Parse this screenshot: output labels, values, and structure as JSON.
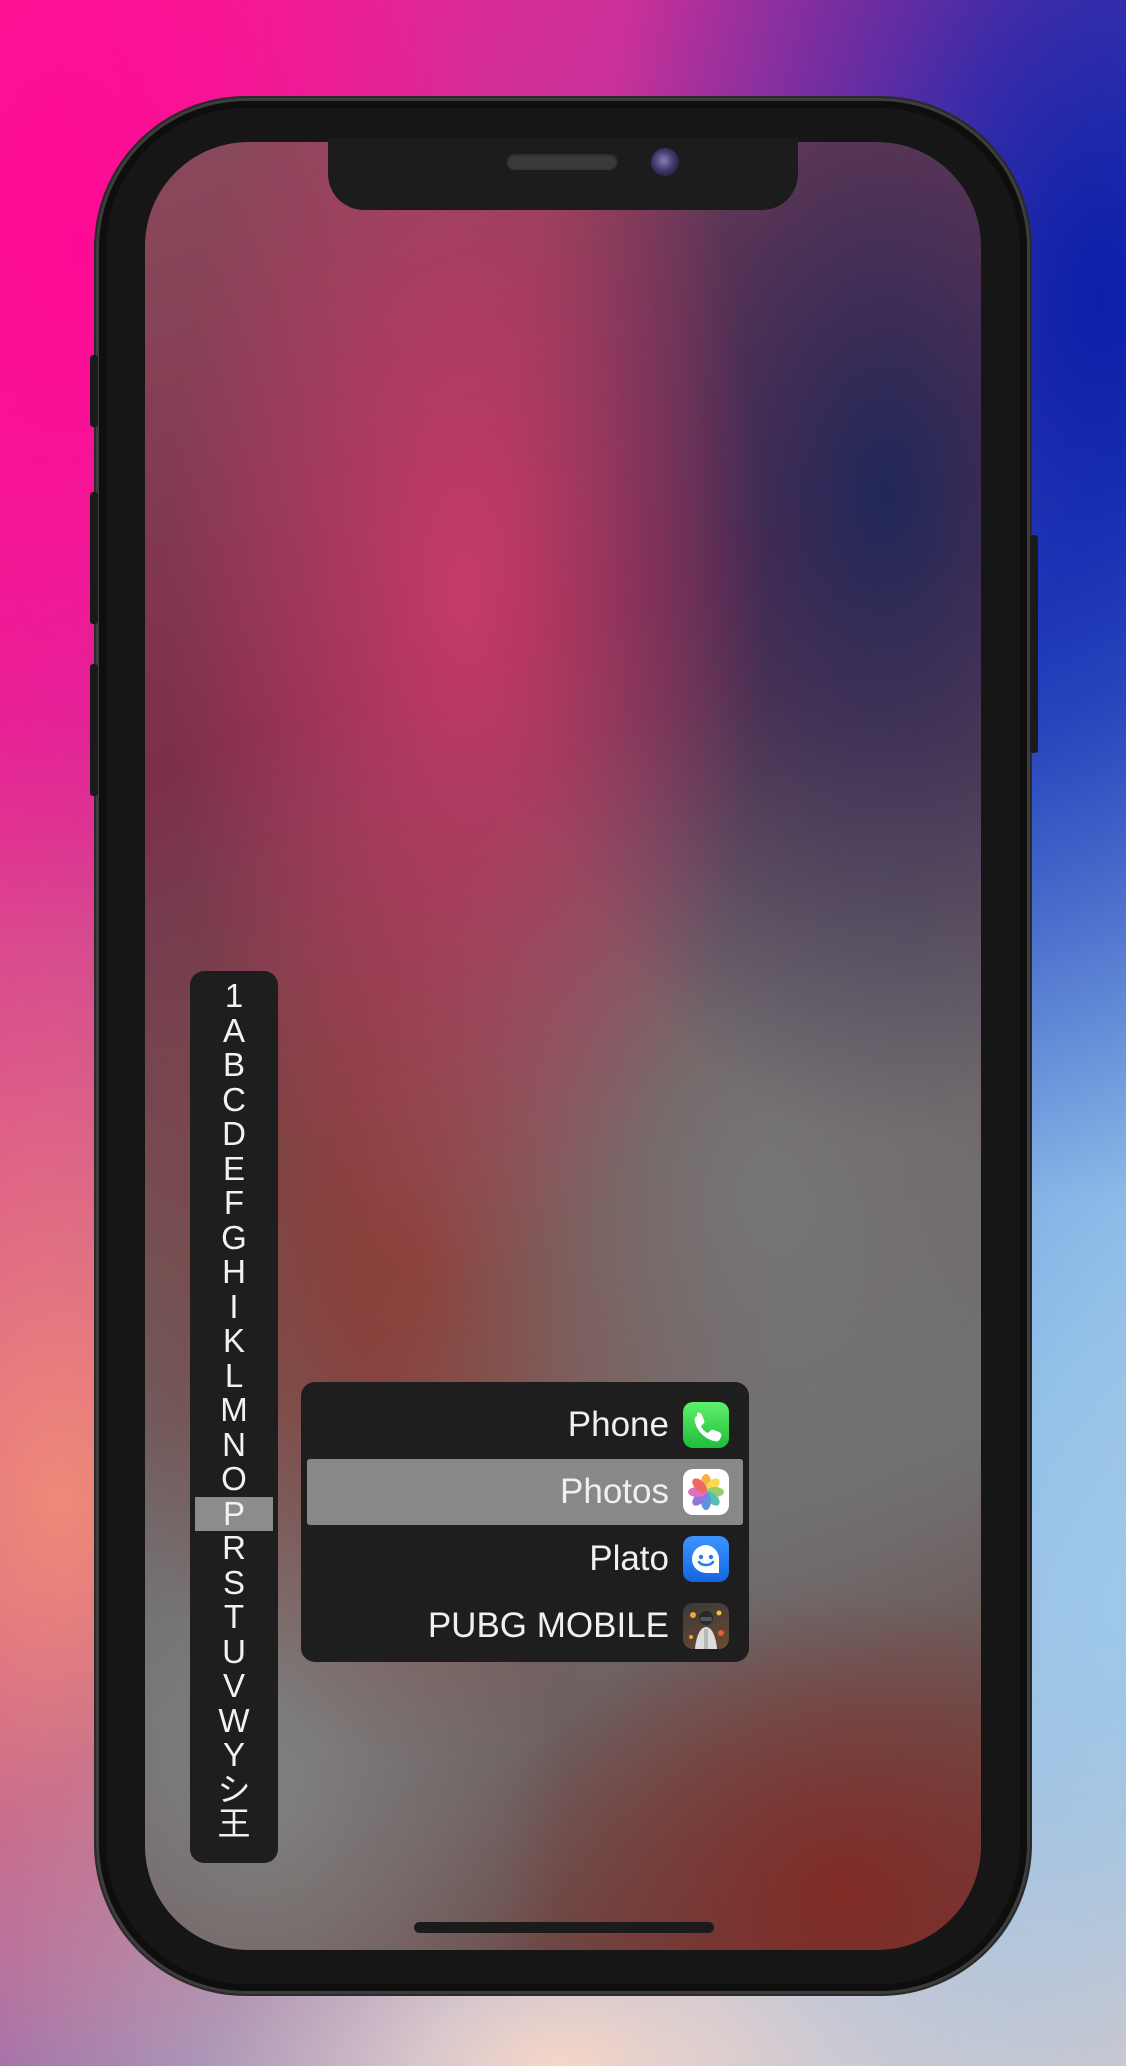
{
  "index_bar": {
    "letters": [
      "1",
      "A",
      "B",
      "C",
      "D",
      "E",
      "F",
      "G",
      "H",
      "I",
      "K",
      "L",
      "M",
      "N",
      "O",
      "P",
      "R",
      "S",
      "T",
      "U",
      "V",
      "W",
      "Y",
      "シ",
      "王"
    ],
    "active": "P"
  },
  "app_list": [
    {
      "name": "Phone",
      "icon": "phone-icon",
      "selected": false
    },
    {
      "name": "Photos",
      "icon": "photos-icon",
      "selected": true
    },
    {
      "name": "Plato",
      "icon": "plato-icon",
      "selected": false
    },
    {
      "name": "PUBG MOBILE",
      "icon": "pubg-mobile-icon",
      "selected": false
    }
  ],
  "colors": {
    "panel": "#1e1e1e",
    "selection": "#888888",
    "phone_icon": "#2fcf4f",
    "plato_icon": "#1e7ef2"
  }
}
